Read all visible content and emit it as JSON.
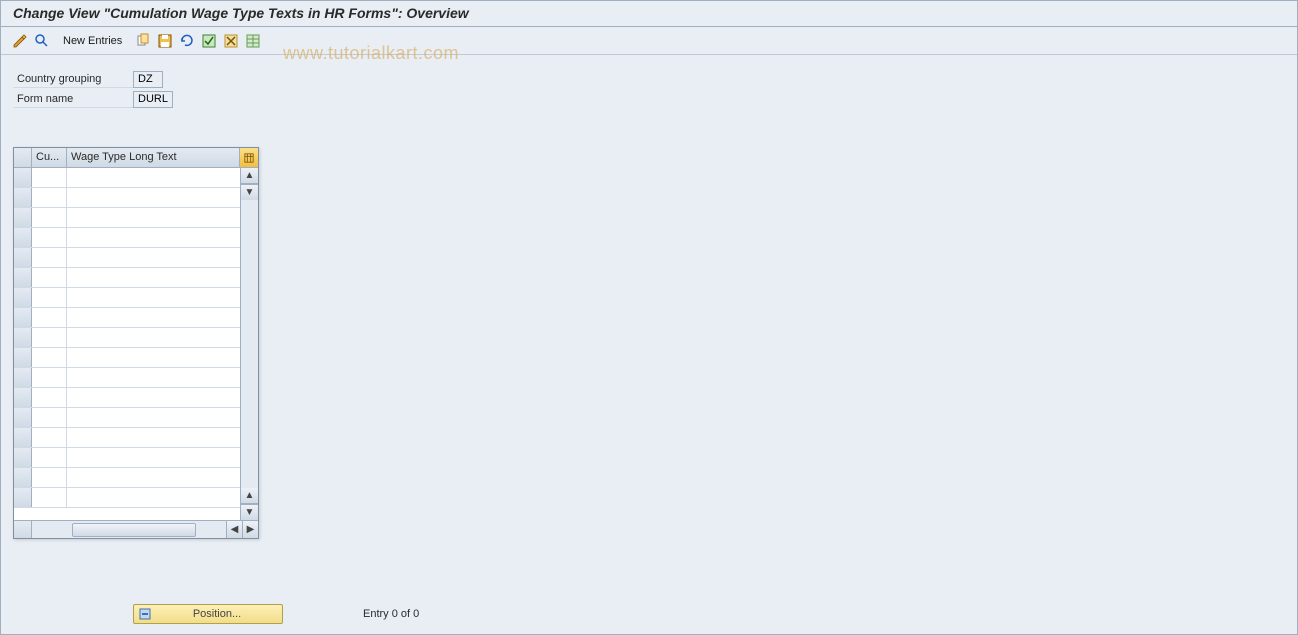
{
  "title": "Change View \"Cumulation Wage Type Texts in HR Forms\": Overview",
  "toolbar": {
    "new_entries_label": "New Entries"
  },
  "watermark": "www.tutorialkart.com",
  "form": {
    "country_grouping_label": "Country grouping",
    "country_grouping_value": "DZ",
    "form_name_label": "Form name",
    "form_name_value": "DURL"
  },
  "table": {
    "columns": {
      "cu": "Cu...",
      "wage_type": "Wage Type Long Text"
    },
    "row_count": 17
  },
  "footer": {
    "position_label": "Position...",
    "entry_text": "Entry 0 of 0"
  }
}
